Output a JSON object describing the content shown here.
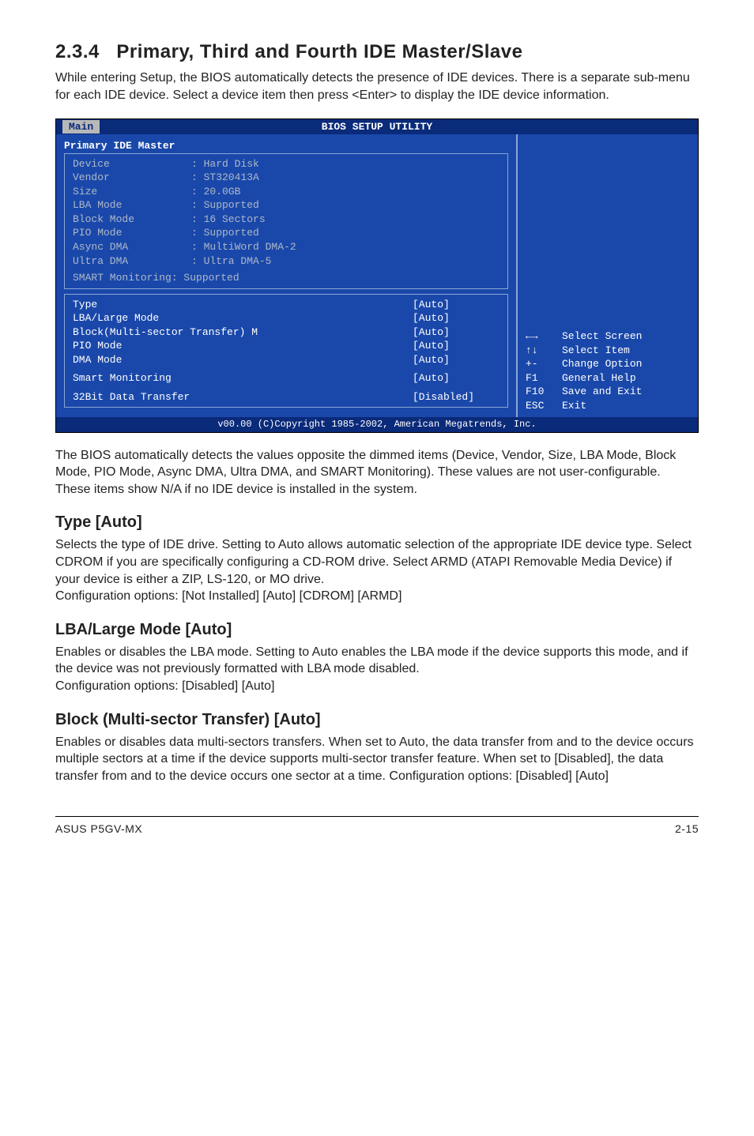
{
  "section": {
    "number": "2.3.4",
    "title": "Primary, Third and Fourth IDE Master/Slave",
    "intro": "While entering Setup, the BIOS automatically detects the presence of IDE devices. There is a separate sub-menu for each IDE device. Select a device item then press <Enter> to display the IDE device information."
  },
  "bios": {
    "utility_title": "BIOS SETUP UTILITY",
    "tab": "Main",
    "panel_title": "Primary IDE Master",
    "info": {
      "device_label": "Device",
      "device_val": ": Hard Disk",
      "vendor_label": "Vendor",
      "vendor_val": ": ST320413A",
      "size_label": "Size",
      "size_val": ": 20.0GB",
      "lba_label": "LBA Mode",
      "lba_val": ": Supported",
      "block_label": "Block Mode",
      "block_val": ": 16 Sectors",
      "pio_label": "PIO Mode",
      "pio_val": ": Supported",
      "async_label": "Async DMA",
      "async_val": ": MultiWord DMA-2",
      "ultra_label": "Ultra DMA",
      "ultra_val": ": Ultra DMA-5",
      "smart": "SMART Monitoring: Supported"
    },
    "settings": {
      "type_label": "Type",
      "type_val": "[Auto]",
      "lba_label": "LBA/Large Mode",
      "lba_val": "[Auto]",
      "block_label": "Block(Multi-sector Transfer) M",
      "block_val": "[Auto]",
      "pio_label": "PIO Mode",
      "pio_val": "[Auto]",
      "dma_label": "DMA Mode",
      "dma_val": "[Auto]",
      "smart_label": "Smart Monitoring",
      "smart_val": "[Auto]",
      "xfer_label": "32Bit Data Transfer",
      "xfer_val": "[Disabled]"
    },
    "help": {
      "l1k": "←→",
      "l1t": "Select Screen",
      "l2k": "↑↓",
      "l2t": "Select Item",
      "l3k": "+-",
      "l3t": "Change Option",
      "l4k": "F1",
      "l4t": "General Help",
      "l5k": "F10",
      "l5t": "Save and Exit",
      "l6k": "ESC",
      "l6t": "Exit"
    },
    "footer": "v00.00 (C)Copyright 1985-2002, American Megatrends, Inc."
  },
  "para_after_bios": "The BIOS automatically detects the values opposite the dimmed items (Device, Vendor, Size, LBA Mode, Block Mode, PIO Mode, Async DMA, Ultra DMA, and SMART Monitoring). These values are not user-configurable. These items show N/A if no IDE device is installed in the system.",
  "type_section": {
    "head": "Type [Auto]",
    "body": "Selects the type of IDE drive. Setting to Auto allows automatic selection of the appropriate IDE device type. Select CDROM if you are specifically configuring a CD-ROM drive. Select ARMD (ATAPI Removable Media Device) if your device is either a ZIP, LS-120, or MO drive.",
    "opts": "Configuration options: [Not Installed] [Auto] [CDROM] [ARMD]"
  },
  "lba_section": {
    "head": "LBA/Large Mode [Auto]",
    "body": "Enables or disables the LBA mode. Setting to Auto enables the LBA mode if the device supports this mode, and if the device was not previously formatted with LBA mode disabled.",
    "opts": "Configuration options: [Disabled] [Auto]"
  },
  "block_section": {
    "head": "Block (Multi-sector Transfer) [Auto]",
    "body": "Enables or disables data multi-sectors transfers. When set to Auto, the data transfer from and to the device occurs multiple sectors at a time if the device supports multi-sector transfer feature. When set to [Disabled], the data transfer from and to the device occurs one sector at a time. Configuration options: [Disabled] [Auto]"
  },
  "footer": {
    "left": "ASUS P5GV-MX",
    "right": "2-15"
  },
  "chart_data": {
    "type": "table",
    "title": "Primary IDE Master (BIOS detected values)",
    "rows": [
      {
        "field": "Device",
        "value": "Hard Disk"
      },
      {
        "field": "Vendor",
        "value": "ST320413A"
      },
      {
        "field": "Size",
        "value": "20.0GB"
      },
      {
        "field": "LBA Mode",
        "value": "Supported"
      },
      {
        "field": "Block Mode",
        "value": "16 Sectors"
      },
      {
        "field": "PIO Mode",
        "value": "Supported"
      },
      {
        "field": "Async DMA",
        "value": "MultiWord DMA-2"
      },
      {
        "field": "Ultra DMA",
        "value": "Ultra DMA-5"
      },
      {
        "field": "SMART Monitoring",
        "value": "Supported"
      },
      {
        "field": "Type",
        "value": "Auto"
      },
      {
        "field": "LBA/Large Mode",
        "value": "Auto"
      },
      {
        "field": "Block(Multi-sector Transfer)",
        "value": "Auto"
      },
      {
        "field": "PIO Mode (setting)",
        "value": "Auto"
      },
      {
        "field": "DMA Mode",
        "value": "Auto"
      },
      {
        "field": "Smart Monitoring",
        "value": "Auto"
      },
      {
        "field": "32Bit Data Transfer",
        "value": "Disabled"
      }
    ]
  }
}
